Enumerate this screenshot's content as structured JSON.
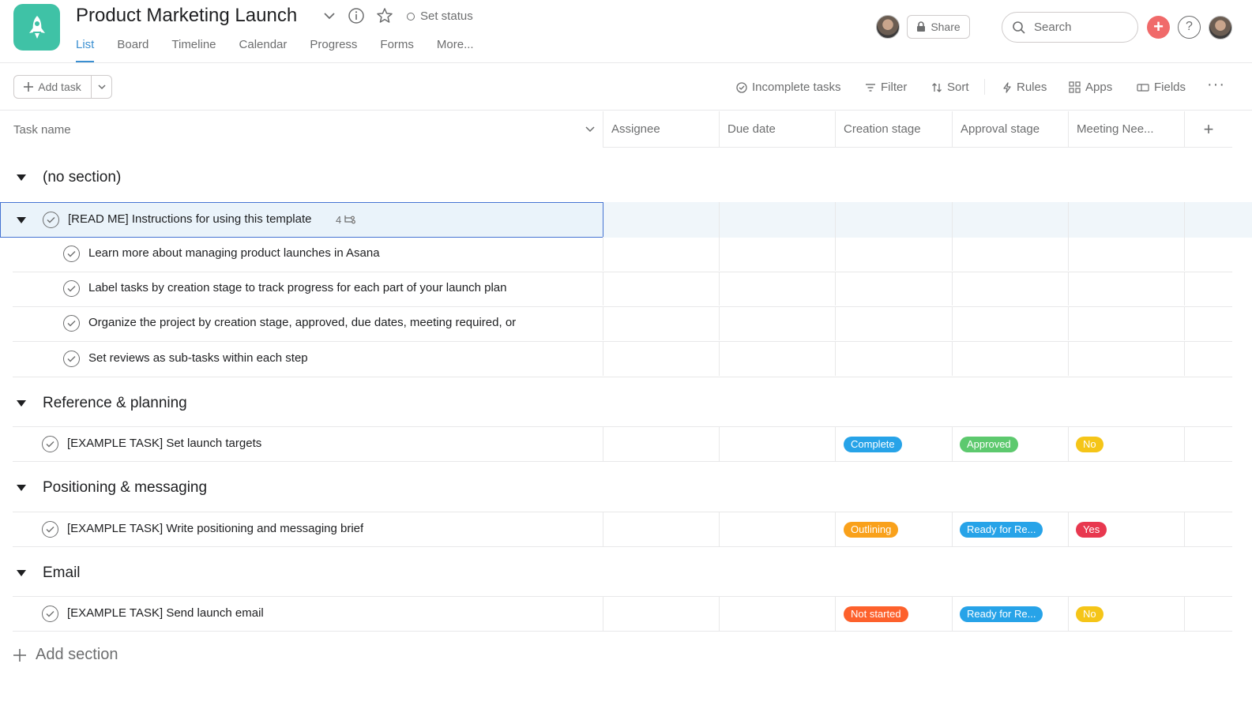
{
  "project": {
    "title": "Product Marketing Launch",
    "set_status": "Set status",
    "tabs": [
      "List",
      "Board",
      "Timeline",
      "Calendar",
      "Progress",
      "Forms",
      "More..."
    ],
    "active_tab": "List"
  },
  "header_right": {
    "share_label": "Share",
    "search_placeholder": "Search",
    "help_label": "?"
  },
  "toolbar": {
    "add_task_label": "Add task",
    "incomplete_tasks": "Incomplete tasks",
    "filter": "Filter",
    "sort": "Sort",
    "rules": "Rules",
    "apps": "Apps",
    "fields": "Fields",
    "more": "···"
  },
  "columns": {
    "task_name": "Task name",
    "assignee": "Assignee",
    "due_date": "Due date",
    "creation_stage": "Creation stage",
    "approval_stage": "Approval stage",
    "meeting_needed": "Meeting Nee..."
  },
  "sections": [
    {
      "name": "(no section)",
      "parent_task": {
        "name": "[READ ME] Instructions for using this template",
        "subtask_count": "4"
      },
      "subtasks": [
        "Learn more about managing product launches in Asana",
        "Label tasks by creation stage to track progress for each part of your launch plan",
        "Organize the project by creation stage, approved, due dates, meeting required, or",
        "Set reviews as sub-tasks within each step"
      ]
    },
    {
      "name": "Reference & planning",
      "task": {
        "name": "[EXAMPLE TASK] Set launch targets",
        "creation": "Complete",
        "approval": "Approved",
        "meeting": "No"
      }
    },
    {
      "name": "Positioning & messaging",
      "task": {
        "name": "[EXAMPLE TASK] Write positioning and messaging brief",
        "creation": "Outlining",
        "approval": "Ready for Re...",
        "meeting": "Yes"
      }
    },
    {
      "name": "Email",
      "task": {
        "name": "[EXAMPLE TASK] Send launch email",
        "creation": "Not started",
        "approval": "Ready for Re...",
        "meeting": "No"
      }
    }
  ],
  "add_section_label": "Add section",
  "colors": {
    "accent": "#3a8fd1",
    "project_icon": "#3fc2a6",
    "pill_complete": "#27a3e8",
    "pill_approved": "#5dc96e",
    "pill_no": "#f5c518",
    "pill_yes": "#e8384f",
    "pill_outlining": "#f9a11b",
    "pill_ready": "#27a3e8",
    "pill_not_started": "#fd612c"
  }
}
